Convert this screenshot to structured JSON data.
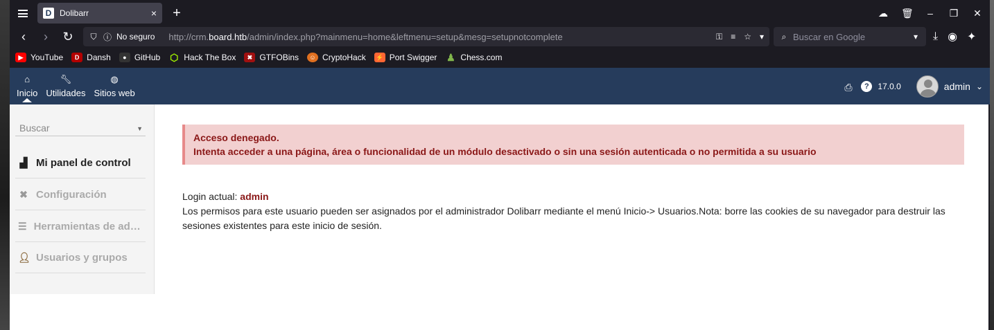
{
  "tab": {
    "title": "Dolibarr",
    "favicon": "D"
  },
  "urlbar": {
    "security": "No seguro",
    "url_prefix": "http://crm.",
    "url_host": "board.htb",
    "url_path": "/admin/index.php?mainmenu=home&leftmenu=setup&mesg=setupnotcomplete"
  },
  "search": {
    "placeholder": "Buscar en Google"
  },
  "bookmarks": [
    {
      "label": "YouTube",
      "color": "#ff0000",
      "glyph": "▶"
    },
    {
      "label": "Dansh",
      "color": "#b30000",
      "glyph": "D"
    },
    {
      "label": "GitHub",
      "color": "#333333",
      "glyph": "●"
    },
    {
      "label": "Hack The Box",
      "color": "#9fef00",
      "glyph": "⬡"
    },
    {
      "label": "GTFOBins",
      "color": "#a01010",
      "glyph": "✖"
    },
    {
      "label": "CryptoHack",
      "color": "#e07020",
      "glyph": "☺"
    },
    {
      "label": "Port Swigger",
      "color": "#ff6633",
      "glyph": "⚡"
    },
    {
      "label": "Chess.com",
      "color": "#81b64c",
      "glyph": "♟"
    }
  ],
  "topmenu": [
    {
      "label": "Inicio",
      "icon": "home-icon"
    },
    {
      "label": "Utilidades",
      "icon": "wrench-icon"
    },
    {
      "label": "Sitios web",
      "icon": "globe-icon"
    }
  ],
  "header": {
    "version": "17.0.0",
    "user": "admin"
  },
  "leftmenu": {
    "search_placeholder": "Buscar",
    "items": [
      {
        "label": "Mi panel de control",
        "icon": "chart-icon"
      },
      {
        "label": "Configuración",
        "icon": "tools-icon"
      },
      {
        "label": "Herramientas de administración",
        "icon": "server-icon"
      },
      {
        "label": "Usuarios y grupos",
        "icon": "user-icon"
      }
    ]
  },
  "alert": {
    "title": "Acceso denegado.",
    "message": "Intenta acceder a una página, área o funcionalidad de un módulo desactivado o sin una sesión autenticada o no permitida a su usuario"
  },
  "info": {
    "login_label": "Login actual: ",
    "login_user": "admin",
    "permissions_text": "Los permisos para este usuario pueden ser asignados por el administrador Dolibarr mediante el menú Inicio-> Usuarios.Nota: borre las cookies de su navegador para destruir las sesiones existentes para este inicio de sesión."
  }
}
